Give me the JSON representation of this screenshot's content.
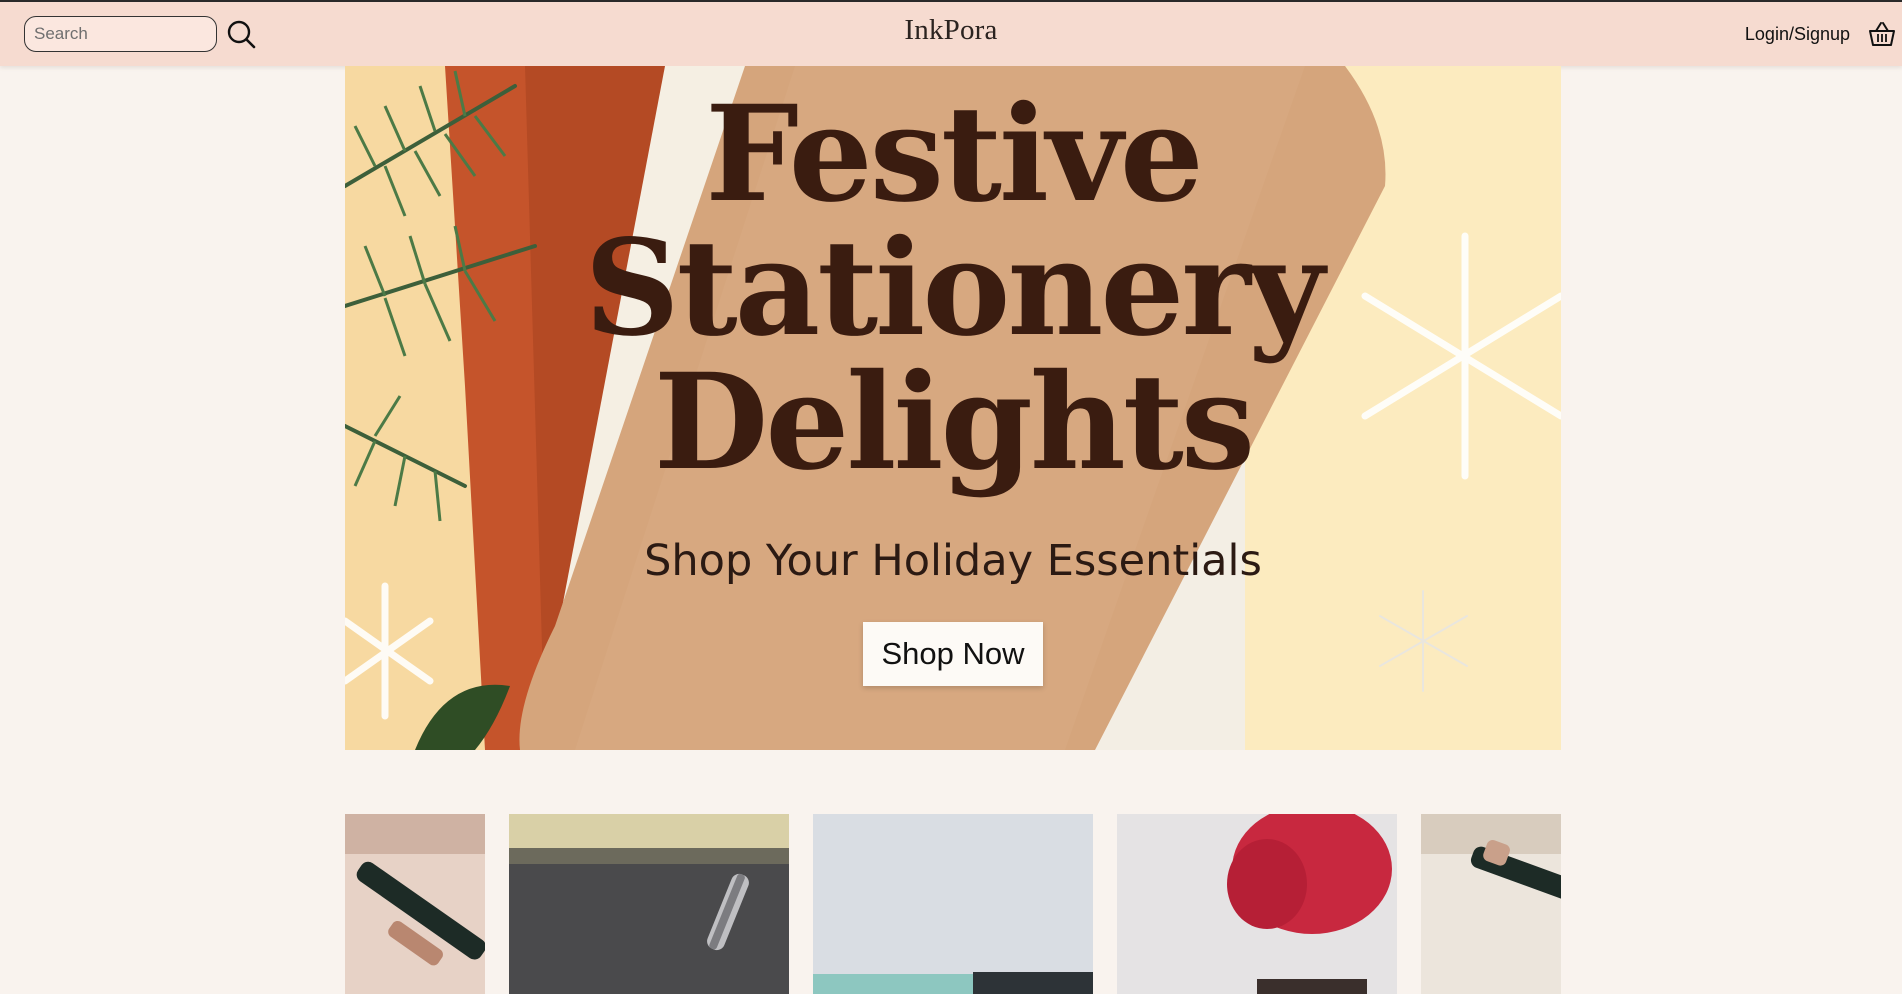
{
  "header": {
    "search_placeholder": "Search",
    "logo": "InkPora",
    "login_label": "Login/Signup"
  },
  "hero": {
    "title_lines": [
      "Festive",
      "Stationery",
      "Delights"
    ],
    "subtitle": "Shop Your Holiday Essentials",
    "cta_label": "Shop Now"
  },
  "icons": {
    "search": "search-icon",
    "cart": "basket-icon"
  },
  "colors": {
    "header_bg": "#f6dbd0",
    "page_bg": "#f9f3ee",
    "title_text": "#3a1c10",
    "button_bg": "#fdfaf6"
  }
}
